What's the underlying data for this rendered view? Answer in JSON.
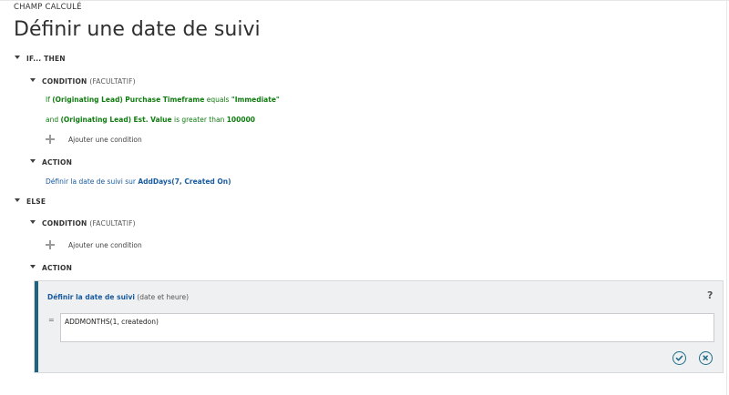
{
  "header": {
    "label": "CHAMP CALCULÉ",
    "title": "Définir une date de suivi"
  },
  "if_then": {
    "label": "IF... THEN",
    "condition": {
      "label": "CONDITION",
      "optional": "(FACULTATIF)",
      "line1": {
        "prefix": "If ",
        "entity": "(Originating Lead)",
        "field": "Purchase Timeframe",
        "operator": " equals ",
        "value": "\"Immediate\""
      },
      "line2": {
        "prefix": "and ",
        "entity": "(Originating Lead)",
        "field": "Est. Value",
        "operator": " is greater than ",
        "value": "100000"
      },
      "add_label": "Ajouter une condition"
    },
    "action": {
      "label": "ACTION",
      "text": "Définir la date de suivi sur ",
      "expr": "AddDays(7, Created On)"
    }
  },
  "else": {
    "label": "ELSE",
    "condition": {
      "label": "CONDITION",
      "optional": "(FACULTATIF)",
      "add_label": "Ajouter une condition"
    },
    "action": {
      "label": "ACTION",
      "editor": {
        "title": "Définir la date de suivi",
        "hint": "(date et heure)",
        "help": "?",
        "equals": "=",
        "formula": "ADDMONTHS(1, createdon)",
        "confirm_icon": "checkmark-circle-icon",
        "cancel_icon": "close-circle-icon"
      }
    }
  },
  "colors": {
    "condition_text": "#107c10",
    "action_text": "#185a9d",
    "accent_bar": "#20647b",
    "editor_bg": "#eff0f2"
  }
}
